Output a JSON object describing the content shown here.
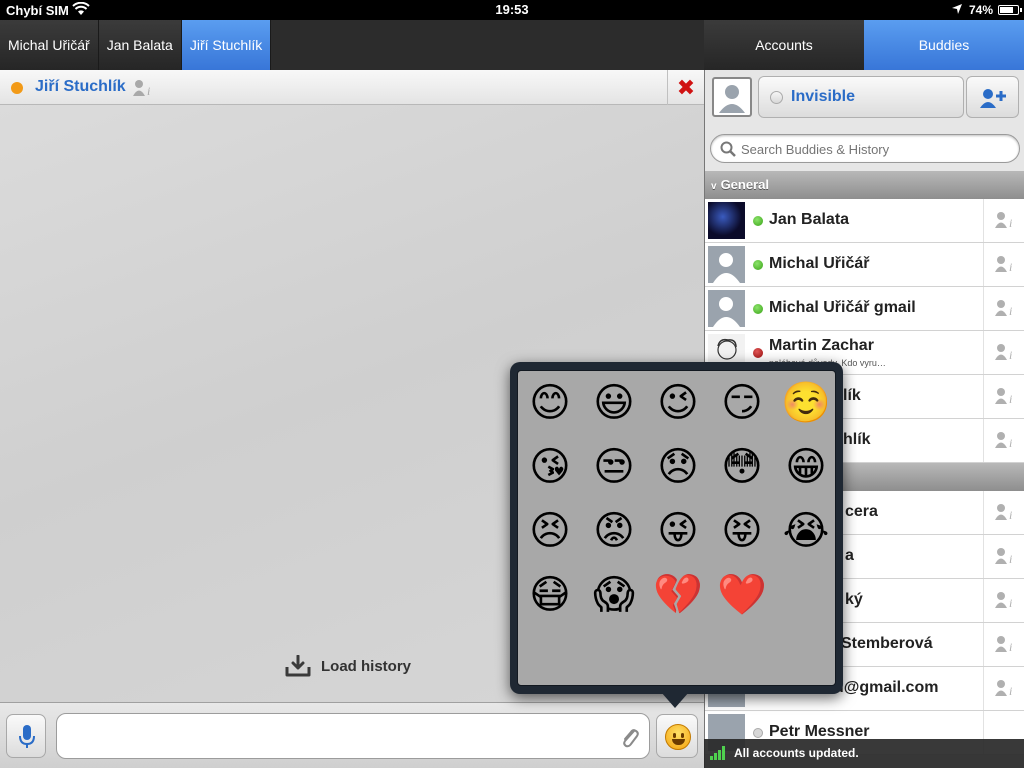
{
  "statusbar": {
    "carrier": "Chybí SIM",
    "time": "19:53",
    "battery": "74%"
  },
  "chat_tabs": [
    {
      "label": "Michal Uřičář",
      "active": false
    },
    {
      "label": "Jan Balata",
      "active": false
    },
    {
      "label": "Jiří Stuchlík",
      "active": true
    }
  ],
  "side_tabs": {
    "accounts": "Accounts",
    "buddies": "Buddies"
  },
  "chat": {
    "contact_name": "Jiří Stuchlík",
    "contact_status_color": "#f29a17",
    "load_history": "Load history"
  },
  "composer": {
    "message_placeholder": ""
  },
  "buddies": {
    "my_status": "Invisible",
    "search_placeholder": "Search Buddies & History",
    "group_general": "General",
    "items": [
      {
        "name": "Jan Balata",
        "status": "online",
        "message": ""
      },
      {
        "name": "Michal Uřičář",
        "status": "online",
        "message": ""
      },
      {
        "name": "Michal Uřičář gmail",
        "status": "online",
        "message": ""
      },
      {
        "name": "Martin Zachar",
        "status": "busy",
        "message": "naléhavé důvody. Kdo vyru…"
      },
      {
        "name": "lík",
        "status": "hidden",
        "message": ""
      },
      {
        "name": "hlík",
        "status": "hidden",
        "message": ""
      }
    ],
    "items2": [
      {
        "name": "cera",
        "status": "hidden"
      },
      {
        "name": "a",
        "status": "hidden"
      },
      {
        "name": "ký",
        "status": "hidden"
      },
      {
        "name": "Stemberová",
        "status": "hidden"
      },
      {
        "name": "kucera.ad@gmail.com",
        "status": "hidden"
      },
      {
        "name": "Petr Messner",
        "status": "offline"
      }
    ]
  },
  "toast": "All accounts updated.",
  "emoji_grid": [
    "😊",
    "😃",
    "😉",
    "😏",
    "☺️",
    "😘",
    "😒",
    "😞",
    "😳",
    "😁",
    "😣",
    "😡",
    "😜",
    "😝",
    "😭",
    "😷",
    "😱",
    "💔",
    "❤️"
  ]
}
